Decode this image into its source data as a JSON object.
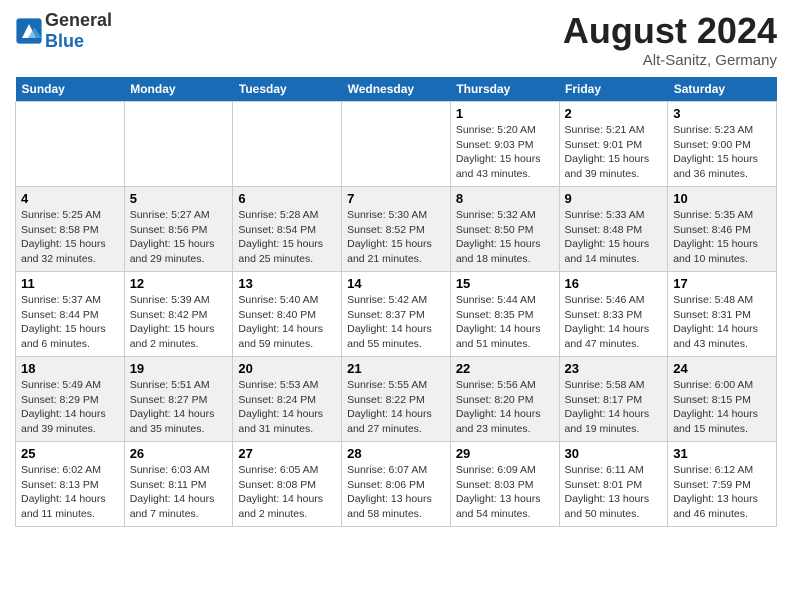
{
  "header": {
    "logo_general": "General",
    "logo_blue": "Blue",
    "month": "August 2024",
    "location": "Alt-Sanitz, Germany"
  },
  "days_of_week": [
    "Sunday",
    "Monday",
    "Tuesday",
    "Wednesday",
    "Thursday",
    "Friday",
    "Saturday"
  ],
  "weeks": [
    [
      {
        "day": "",
        "info": ""
      },
      {
        "day": "",
        "info": ""
      },
      {
        "day": "",
        "info": ""
      },
      {
        "day": "",
        "info": ""
      },
      {
        "day": "1",
        "info": "Sunrise: 5:20 AM\nSunset: 9:03 PM\nDaylight: 15 hours\nand 43 minutes."
      },
      {
        "day": "2",
        "info": "Sunrise: 5:21 AM\nSunset: 9:01 PM\nDaylight: 15 hours\nand 39 minutes."
      },
      {
        "day": "3",
        "info": "Sunrise: 5:23 AM\nSunset: 9:00 PM\nDaylight: 15 hours\nand 36 minutes."
      }
    ],
    [
      {
        "day": "4",
        "info": "Sunrise: 5:25 AM\nSunset: 8:58 PM\nDaylight: 15 hours\nand 32 minutes."
      },
      {
        "day": "5",
        "info": "Sunrise: 5:27 AM\nSunset: 8:56 PM\nDaylight: 15 hours\nand 29 minutes."
      },
      {
        "day": "6",
        "info": "Sunrise: 5:28 AM\nSunset: 8:54 PM\nDaylight: 15 hours\nand 25 minutes."
      },
      {
        "day": "7",
        "info": "Sunrise: 5:30 AM\nSunset: 8:52 PM\nDaylight: 15 hours\nand 21 minutes."
      },
      {
        "day": "8",
        "info": "Sunrise: 5:32 AM\nSunset: 8:50 PM\nDaylight: 15 hours\nand 18 minutes."
      },
      {
        "day": "9",
        "info": "Sunrise: 5:33 AM\nSunset: 8:48 PM\nDaylight: 15 hours\nand 14 minutes."
      },
      {
        "day": "10",
        "info": "Sunrise: 5:35 AM\nSunset: 8:46 PM\nDaylight: 15 hours\nand 10 minutes."
      }
    ],
    [
      {
        "day": "11",
        "info": "Sunrise: 5:37 AM\nSunset: 8:44 PM\nDaylight: 15 hours\nand 6 minutes."
      },
      {
        "day": "12",
        "info": "Sunrise: 5:39 AM\nSunset: 8:42 PM\nDaylight: 15 hours\nand 2 minutes."
      },
      {
        "day": "13",
        "info": "Sunrise: 5:40 AM\nSunset: 8:40 PM\nDaylight: 14 hours\nand 59 minutes."
      },
      {
        "day": "14",
        "info": "Sunrise: 5:42 AM\nSunset: 8:37 PM\nDaylight: 14 hours\nand 55 minutes."
      },
      {
        "day": "15",
        "info": "Sunrise: 5:44 AM\nSunset: 8:35 PM\nDaylight: 14 hours\nand 51 minutes."
      },
      {
        "day": "16",
        "info": "Sunrise: 5:46 AM\nSunset: 8:33 PM\nDaylight: 14 hours\nand 47 minutes."
      },
      {
        "day": "17",
        "info": "Sunrise: 5:48 AM\nSunset: 8:31 PM\nDaylight: 14 hours\nand 43 minutes."
      }
    ],
    [
      {
        "day": "18",
        "info": "Sunrise: 5:49 AM\nSunset: 8:29 PM\nDaylight: 14 hours\nand 39 minutes."
      },
      {
        "day": "19",
        "info": "Sunrise: 5:51 AM\nSunset: 8:27 PM\nDaylight: 14 hours\nand 35 minutes."
      },
      {
        "day": "20",
        "info": "Sunrise: 5:53 AM\nSunset: 8:24 PM\nDaylight: 14 hours\nand 31 minutes."
      },
      {
        "day": "21",
        "info": "Sunrise: 5:55 AM\nSunset: 8:22 PM\nDaylight: 14 hours\nand 27 minutes."
      },
      {
        "day": "22",
        "info": "Sunrise: 5:56 AM\nSunset: 8:20 PM\nDaylight: 14 hours\nand 23 minutes."
      },
      {
        "day": "23",
        "info": "Sunrise: 5:58 AM\nSunset: 8:17 PM\nDaylight: 14 hours\nand 19 minutes."
      },
      {
        "day": "24",
        "info": "Sunrise: 6:00 AM\nSunset: 8:15 PM\nDaylight: 14 hours\nand 15 minutes."
      }
    ],
    [
      {
        "day": "25",
        "info": "Sunrise: 6:02 AM\nSunset: 8:13 PM\nDaylight: 14 hours\nand 11 minutes."
      },
      {
        "day": "26",
        "info": "Sunrise: 6:03 AM\nSunset: 8:11 PM\nDaylight: 14 hours\nand 7 minutes."
      },
      {
        "day": "27",
        "info": "Sunrise: 6:05 AM\nSunset: 8:08 PM\nDaylight: 14 hours\nand 2 minutes."
      },
      {
        "day": "28",
        "info": "Sunrise: 6:07 AM\nSunset: 8:06 PM\nDaylight: 13 hours\nand 58 minutes."
      },
      {
        "day": "29",
        "info": "Sunrise: 6:09 AM\nSunset: 8:03 PM\nDaylight: 13 hours\nand 54 minutes."
      },
      {
        "day": "30",
        "info": "Sunrise: 6:11 AM\nSunset: 8:01 PM\nDaylight: 13 hours\nand 50 minutes."
      },
      {
        "day": "31",
        "info": "Sunrise: 6:12 AM\nSunset: 7:59 PM\nDaylight: 13 hours\nand 46 minutes."
      }
    ]
  ]
}
